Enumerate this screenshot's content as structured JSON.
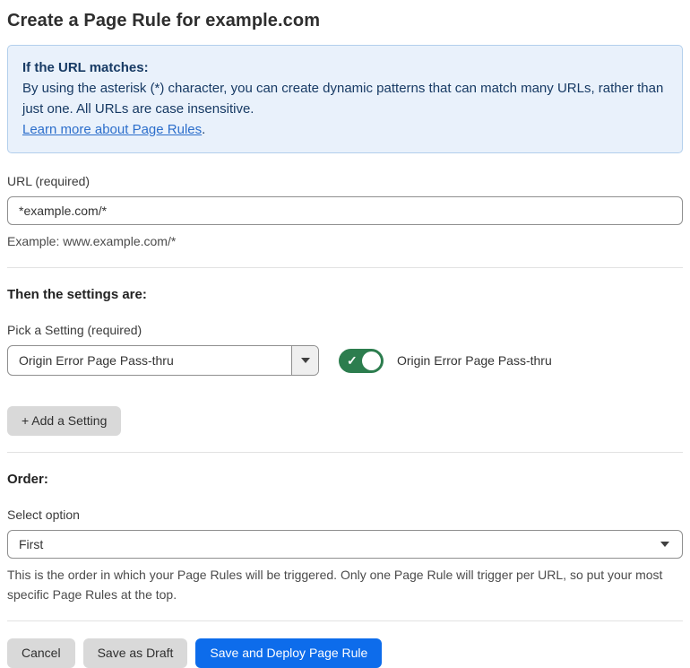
{
  "page": {
    "title": "Create a Page Rule for example.com"
  },
  "info_box": {
    "heading": "If the URL matches:",
    "body": "By using the asterisk (*) character, you can create dynamic patterns that can match many URLs, rather than just one. All URLs are case insensitive.",
    "link_label": "Learn more about Page Rules",
    "link_suffix": "."
  },
  "url_field": {
    "label": "URL (required)",
    "value": "*example.com/*",
    "helper": "Example: www.example.com/*"
  },
  "settings_section": {
    "heading": "Then the settings are:",
    "setting_label": "Pick a Setting (required)",
    "setting_value": "Origin Error Page Pass-thru",
    "toggle_state": "on",
    "toggle_check_glyph": "✓",
    "toggle_label": "Origin Error Page Pass-thru",
    "add_button_label": "+ Add a Setting"
  },
  "order_section": {
    "heading": "Order:",
    "label": "Select option",
    "value": "First",
    "helper": "This is the order in which your Page Rules will be triggered. Only one Page Rule will trigger per URL, so put your most specific Page Rules at the top."
  },
  "footer": {
    "cancel_label": "Cancel",
    "save_draft_label": "Save as Draft",
    "save_deploy_label": "Save and Deploy Page Rule"
  },
  "colors": {
    "accent_blue": "#0d6ceb",
    "toggle_green": "#2c7d4e",
    "info_box_bg": "#e9f1fb",
    "info_box_border": "#b3cfec",
    "info_text": "#173a64",
    "link_blue": "#2c6ecb",
    "button_gray": "#d9d9d9",
    "border_gray": "#8f8f8f"
  },
  "icons": {
    "dropdown_caret": "caret-down",
    "select_caret": "caret-down",
    "toggle_check": "check"
  }
}
